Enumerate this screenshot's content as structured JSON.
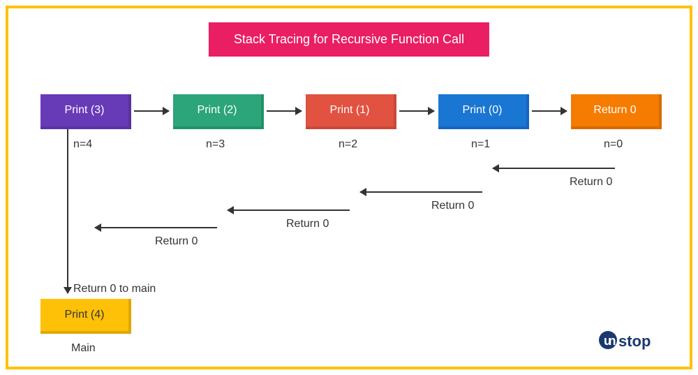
{
  "title": "Stack Tracing for Recursive Function Call",
  "boxes": {
    "b1": {
      "label": "Print (3)",
      "sublabel": "n=4"
    },
    "b2": {
      "label": "Print (2)",
      "sublabel": "n=3"
    },
    "b3": {
      "label": "Print (1)",
      "sublabel": "n=2"
    },
    "b4": {
      "label": "Print (0)",
      "sublabel": "n=1"
    },
    "b5": {
      "label": "Return 0",
      "sublabel": "n=0"
    },
    "b6": {
      "label": "Print (4)",
      "sublabel": "Main"
    }
  },
  "returns": {
    "r1": "Return 0",
    "r2": "Return 0",
    "r3": "Return 0",
    "r4": "Return 0",
    "r5": "Return 0 to main"
  },
  "logo": "unstop"
}
